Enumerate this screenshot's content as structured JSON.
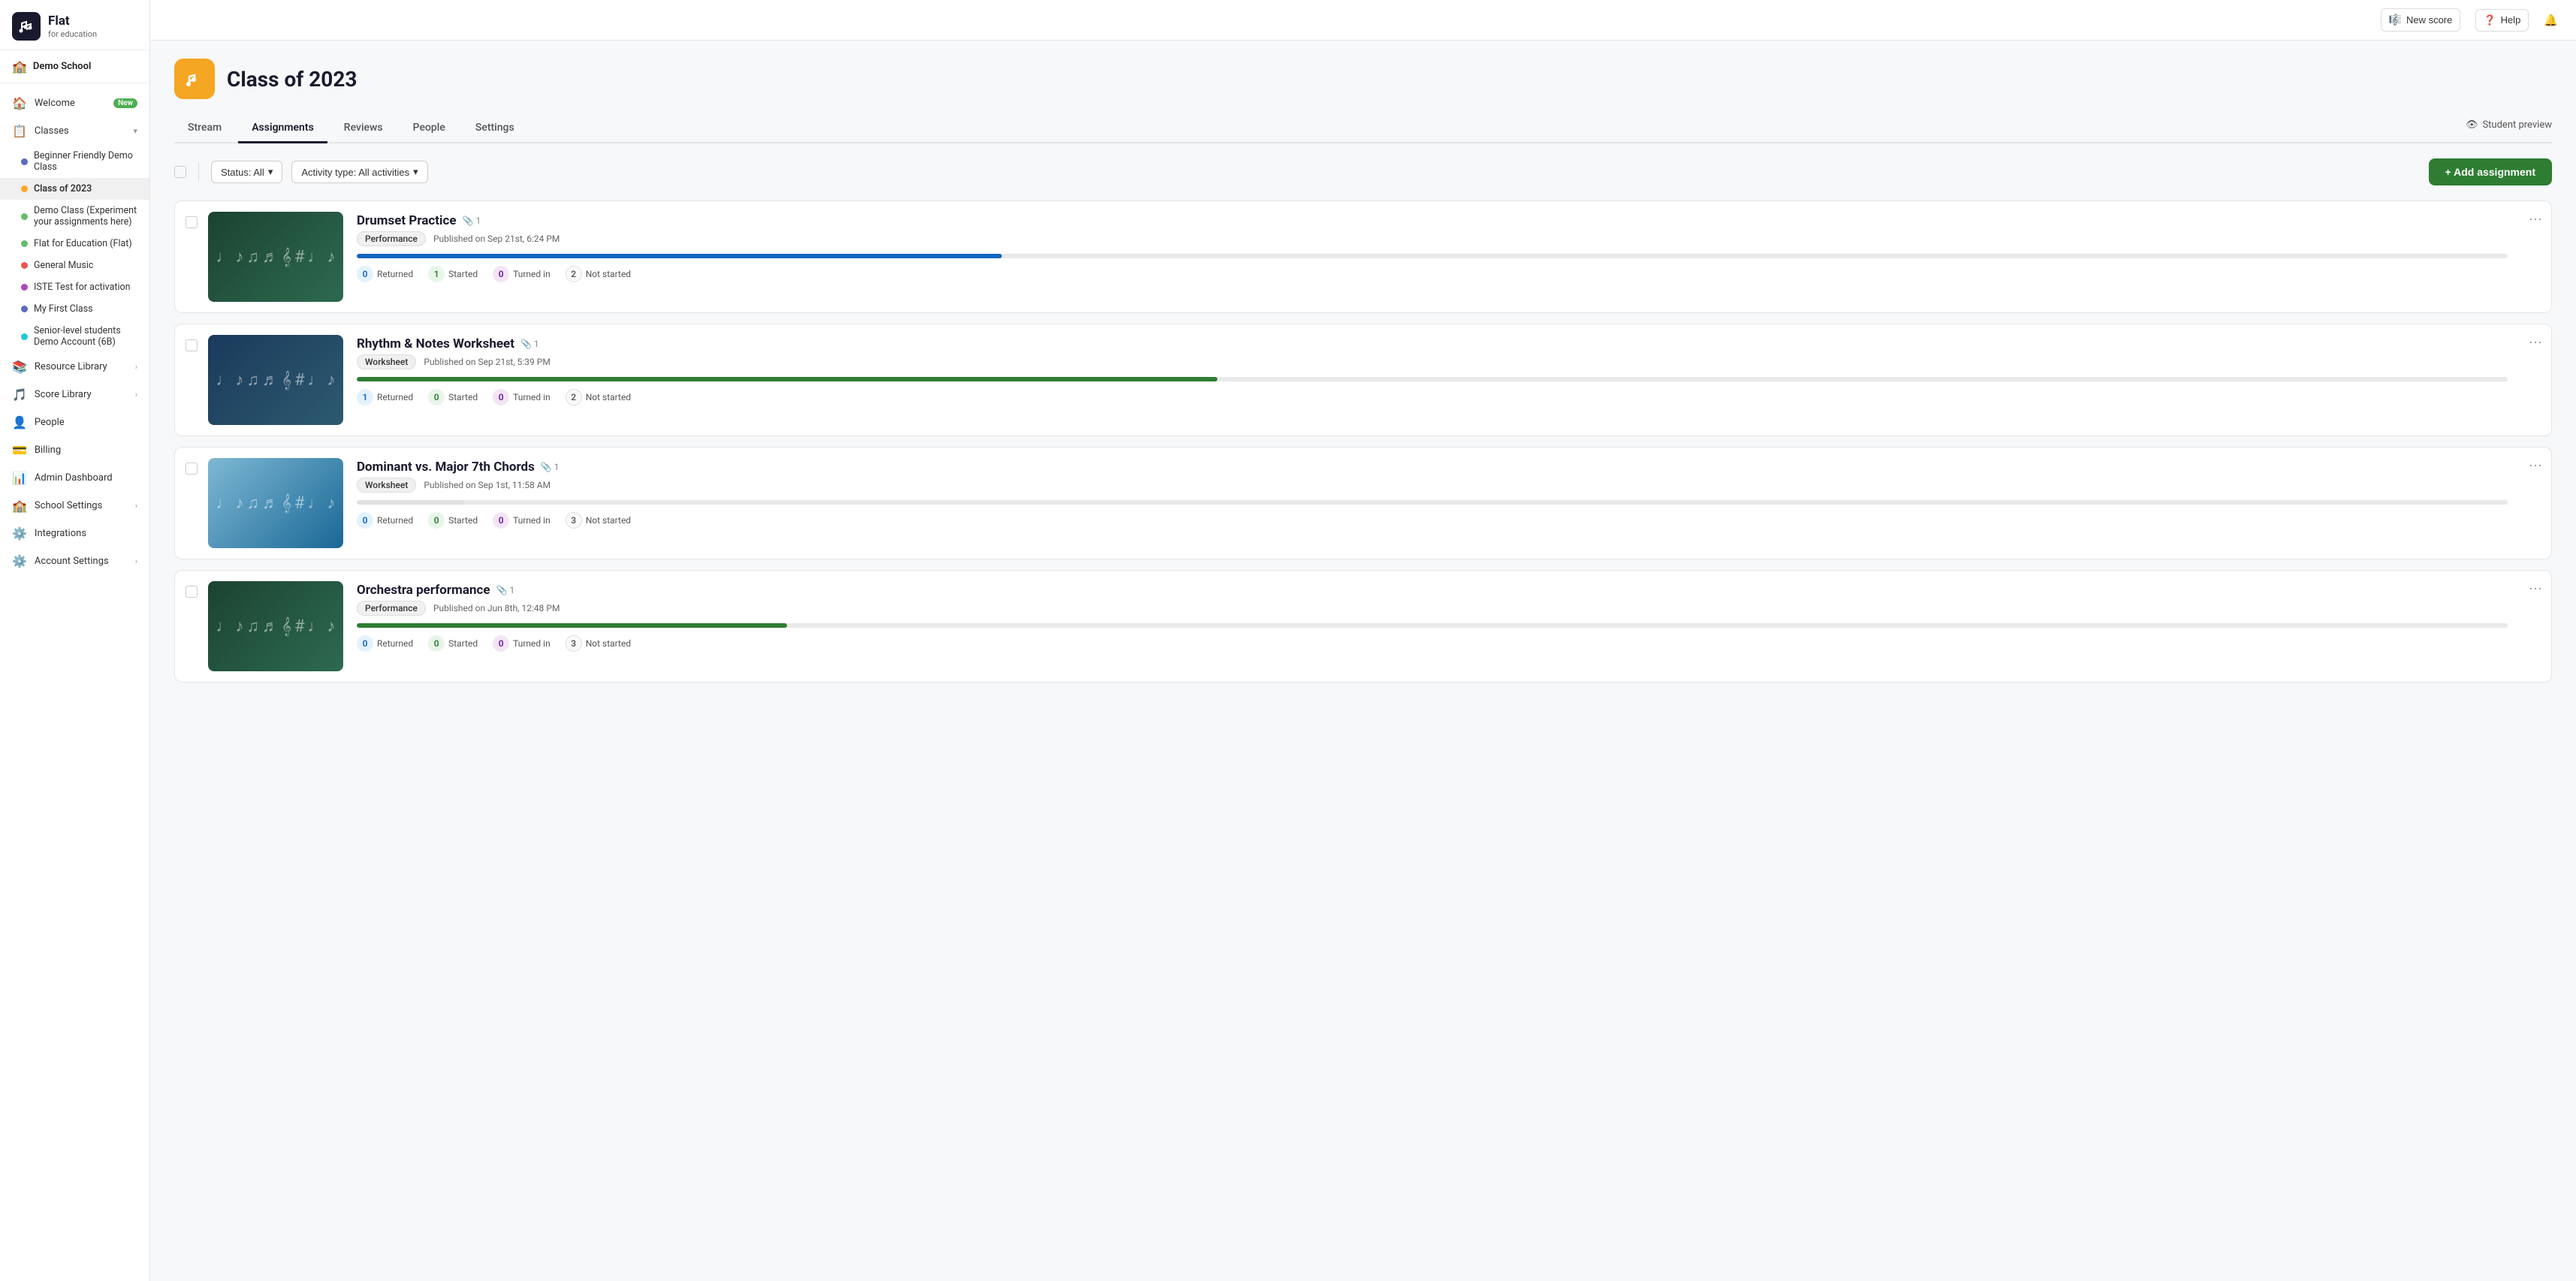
{
  "sidebar": {
    "logo": {
      "flat": "Flat",
      "sub": "for education"
    },
    "school": "Demo School",
    "nav": [
      {
        "id": "welcome",
        "icon": "🏠",
        "label": "Welcome",
        "badge": "New"
      },
      {
        "id": "classes",
        "icon": "📋",
        "label": "Classes",
        "chevron": true
      },
      {
        "id": "resource-library",
        "icon": "📚",
        "label": "Resource Library",
        "chevron": true
      },
      {
        "id": "score-library",
        "icon": "🎵",
        "label": "Score Library",
        "chevron": true
      },
      {
        "id": "people",
        "icon": "👤",
        "label": "People"
      },
      {
        "id": "billing",
        "icon": "💳",
        "label": "Billing"
      },
      {
        "id": "admin-dashboard",
        "icon": "📊",
        "label": "Admin Dashboard"
      },
      {
        "id": "school-settings",
        "icon": "🏫",
        "label": "School Settings",
        "chevron": true
      },
      {
        "id": "integrations",
        "icon": "⚙️",
        "label": "Integrations"
      },
      {
        "id": "account-settings",
        "icon": "⚙️",
        "label": "Account Settings",
        "chevron": true
      }
    ],
    "classes": [
      {
        "id": "beginner",
        "label": "Beginner Friendly Demo Class",
        "color": "#5c6bc0"
      },
      {
        "id": "class-2023",
        "label": "Class of 2023",
        "color": "#ffa726",
        "active": true
      },
      {
        "id": "demo-class",
        "label": "Demo Class (Experiment your assignments here)",
        "color": "#66bb6a"
      },
      {
        "id": "flat-edu",
        "label": "Flat for Education (Flat)",
        "color": "#66bb6a"
      },
      {
        "id": "general-music",
        "label": "General Music",
        "color": "#ef5350"
      },
      {
        "id": "iste-test",
        "label": "ISTE Test for activation",
        "color": "#ab47bc"
      },
      {
        "id": "my-first",
        "label": "My First Class",
        "color": "#5c6bc0"
      },
      {
        "id": "senior-level",
        "label": "Senior-level students Demo Account (6B)",
        "color": "#26c6da"
      }
    ]
  },
  "topbar": {
    "new_score_label": "New score",
    "help_label": "Help",
    "notification_icon": "🔔"
  },
  "page": {
    "class_icon": "🎵",
    "class_title": "Class of 2023",
    "tabs": [
      "Stream",
      "Assignments",
      "Reviews",
      "People",
      "Settings"
    ],
    "active_tab": "Assignments",
    "student_preview_label": "Student preview"
  },
  "toolbar": {
    "status_label": "Status: All",
    "activity_label": "Activity type: All activities",
    "add_label": "+ Add assignment"
  },
  "assignments": [
    {
      "id": "drumset",
      "title": "Drumset Practice",
      "attachments": "1",
      "type": "Performance",
      "date": "Published on Sep 21st, 6:24 PM",
      "progress": 30,
      "progress_color": "#1565c0",
      "stats": [
        {
          "value": "0",
          "label": "Returned",
          "type": "returned"
        },
        {
          "value": "1",
          "label": "Started",
          "type": "started"
        },
        {
          "value": "0",
          "label": "Turned in",
          "type": "turned-in"
        },
        {
          "value": "2",
          "label": "Not started",
          "type": "not-started"
        }
      ],
      "thumb_style": "green"
    },
    {
      "id": "rhythm",
      "title": "Rhythm & Notes Worksheet",
      "attachments": "1",
      "type": "Worksheet",
      "date": "Published on Sep 21st, 5:39 PM",
      "progress": 40,
      "progress_color": "#2e7d32",
      "stats": [
        {
          "value": "1",
          "label": "Returned",
          "type": "returned"
        },
        {
          "value": "0",
          "label": "Started",
          "type": "started"
        },
        {
          "value": "0",
          "label": "Turned in",
          "type": "turned-in"
        },
        {
          "value": "2",
          "label": "Not started",
          "type": "not-started"
        }
      ],
      "thumb_style": "blue-dark"
    },
    {
      "id": "dominant",
      "title": "Dominant vs. Major 7th Chords",
      "attachments": "1",
      "type": "Worksheet",
      "date": "Published on Sep 1st, 11:58 AM",
      "progress": 5,
      "progress_color": "#e0e0e0",
      "stats": [
        {
          "value": "0",
          "label": "Returned",
          "type": "returned"
        },
        {
          "value": "0",
          "label": "Started",
          "type": "started"
        },
        {
          "value": "0",
          "label": "Turned in",
          "type": "turned-in"
        },
        {
          "value": "3",
          "label": "Not started",
          "type": "not-started"
        }
      ],
      "thumb_style": "light-blue"
    },
    {
      "id": "orchestra",
      "title": "Orchestra performance",
      "attachments": "1",
      "type": "Performance",
      "date": "Published on Jun 8th, 12:48 PM",
      "progress": 20,
      "progress_color": "#2e7d32",
      "stats": [
        {
          "value": "0",
          "label": "Returned",
          "type": "returned"
        },
        {
          "value": "0",
          "label": "Started",
          "type": "started"
        },
        {
          "value": "0",
          "label": "Turned in",
          "type": "turned-in"
        },
        {
          "value": "3",
          "label": "Not started",
          "type": "not-started"
        }
      ],
      "thumb_style": "green"
    }
  ]
}
